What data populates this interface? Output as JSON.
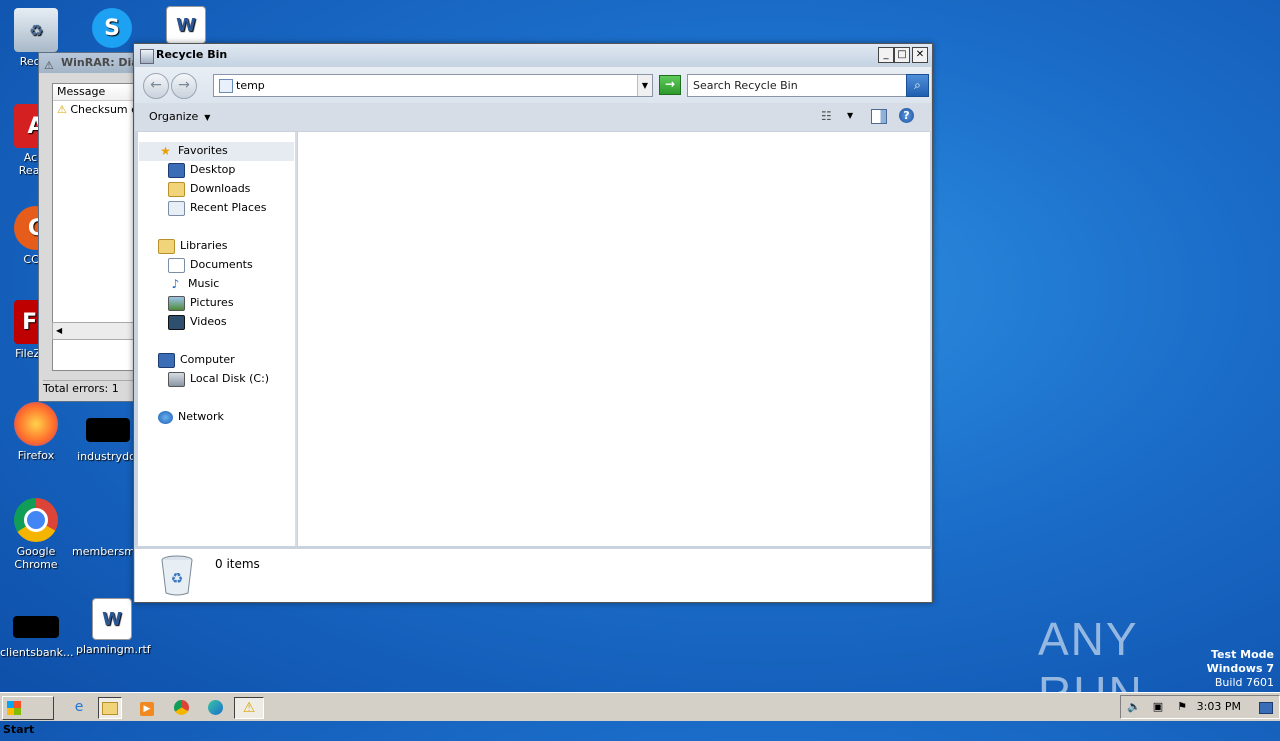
{
  "desktop": {
    "icons": [
      {
        "label": "Recyc",
        "icon": "recycle-bin-icon"
      },
      {
        "label": "Acro\nReade",
        "icon": "acrobat-reader-icon"
      },
      {
        "label": "CCle",
        "icon": "ccleaner-icon"
      },
      {
        "label": "FileZilla",
        "icon": "filezilla-icon"
      },
      {
        "label": "Firefox",
        "icon": "firefox-icon"
      },
      {
        "label": "industrydol",
        "icon": "document-icon"
      },
      {
        "label": "Google\nChrome",
        "icon": "chrome-icon"
      },
      {
        "label": "membersm...",
        "icon": "document-icon"
      },
      {
        "label": "clientsbank...",
        "icon": "document-icon"
      },
      {
        "label": "planningm.rtf",
        "icon": "word-document-icon"
      }
    ]
  },
  "winrar": {
    "title": "WinRAR: Diag",
    "column_header": "Message",
    "rows": [
      "Checksum er"
    ],
    "status": "Total errors: 1"
  },
  "explorer": {
    "title": "Recycle Bin",
    "address_value": "temp",
    "search_placeholder": "Search Recycle Bin",
    "organize_label": "Organize",
    "nav": {
      "favorites": "Favorites",
      "desktop": "Desktop",
      "downloads": "Downloads",
      "recent": "Recent Places",
      "libraries": "Libraries",
      "documents": "Documents",
      "music": "Music",
      "pictures": "Pictures",
      "videos": "Videos",
      "computer": "Computer",
      "local_disk": "Local Disk (C:)",
      "network": "Network"
    },
    "details_count": "0 items"
  },
  "watermark": {
    "brand": "ANY RUN",
    "test_mode": "Test Mode",
    "os": "Windows 7",
    "build": "Build 7601"
  },
  "taskbar": {
    "start_label": "Start",
    "clock": "3:03 PM"
  },
  "colors": {
    "desktop_bg": "#1a6cc8",
    "title_bar": "#c5d3e2",
    "taskbar": "#d4d0c8"
  }
}
